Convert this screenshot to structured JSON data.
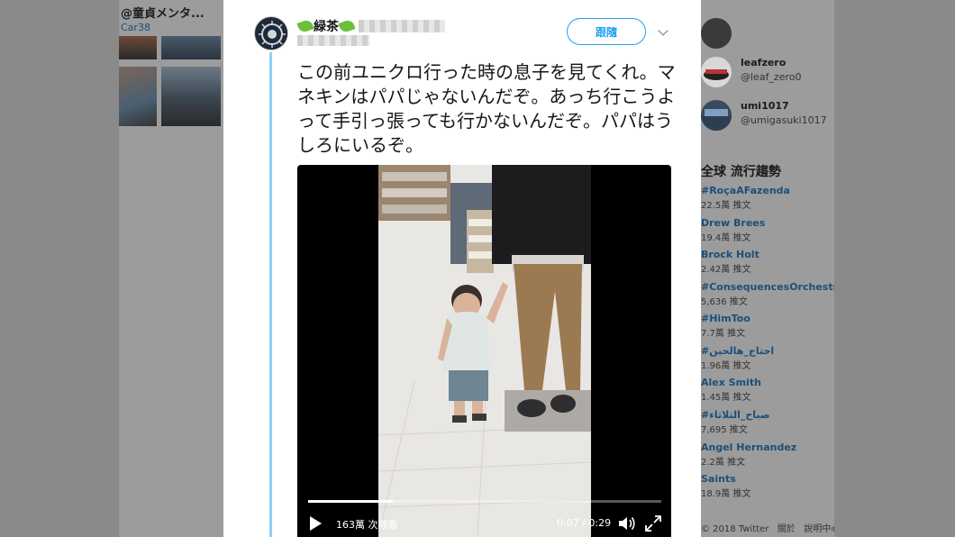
{
  "background_left": {
    "profile_name": "@童貞メンタ...",
    "profile_handle": "Car38"
  },
  "who_to_follow": [
    {
      "name": "leafzero",
      "handle": "@leaf_zero0"
    },
    {
      "name": "umi1017",
      "handle": "@umigasuki1017"
    }
  ],
  "trends": {
    "title": "全球 流行趨勢",
    "items": [
      {
        "name": "#RoçaAFazenda",
        "count": "22.5萬 推文"
      },
      {
        "name": "Drew Brees",
        "count": "19.4萬 推文"
      },
      {
        "name": "Brock Holt",
        "count": "2.42萬 推文"
      },
      {
        "name": "#ConsequencesOrchestra",
        "count": "5,636 推文"
      },
      {
        "name": "#HimToo",
        "count": "7.7萬 推文"
      },
      {
        "name": "#احتاج_هالحين",
        "count": "1.96萬 推文"
      },
      {
        "name": "Alex Smith",
        "count": "1.45萬 推文"
      },
      {
        "name": "#صباح_الثلاثاء",
        "count": "7,695 推文"
      },
      {
        "name": "Angel Hernandez",
        "count": "2.2萬 推文"
      },
      {
        "name": "Saints",
        "count": "18.9萬 推文"
      }
    ]
  },
  "footer": {
    "copyright": "© 2018 Twitter",
    "about": "關於",
    "help": "說明中心"
  },
  "tweet": {
    "display_name": "緑茶",
    "follow_label": "跟隨",
    "text": "この前ユニクロ行った時の息子を見てくれ。マネキンはパパじゃないんだぞ。あっち行こうよって手引っ張っても行かないんだぞ。パパはうしろにいるぞ。"
  },
  "video": {
    "views": "163萬 次觀看",
    "time": "0:07 / 0:29",
    "progress": 0.24
  },
  "colors": {
    "accent": "#1da1f2",
    "thread_line": "#8fd0f7",
    "trend_link": "#1b4f7a"
  }
}
